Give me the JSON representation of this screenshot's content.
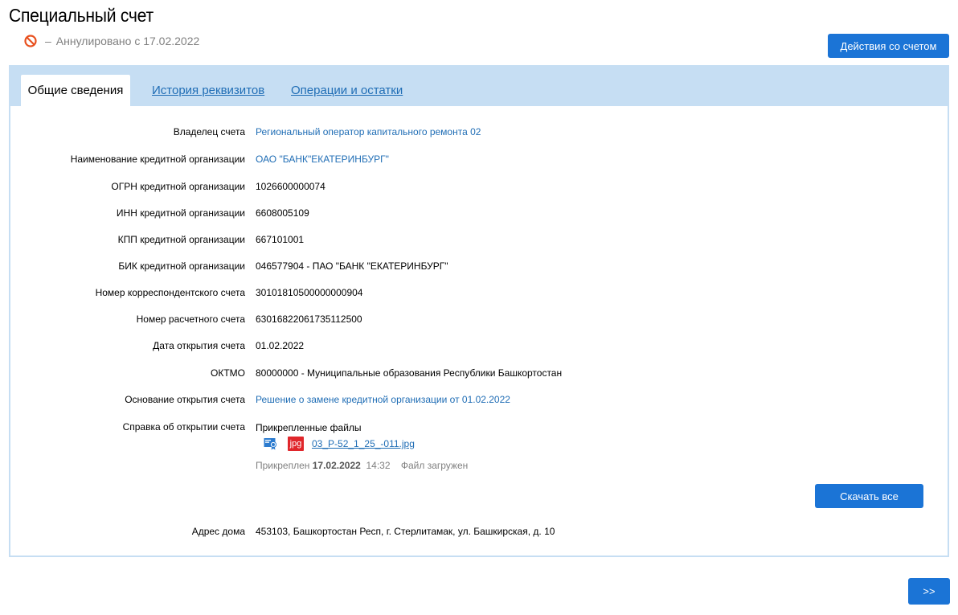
{
  "header": {
    "title": "Специальный счет",
    "status_dash": "–",
    "status_text": "Аннулировано с 17.02.2022",
    "actions_label": "Действия со счетом"
  },
  "tabs": [
    {
      "label": "Общие сведения"
    },
    {
      "label": "История реквизитов"
    },
    {
      "label": "Операции и остатки"
    }
  ],
  "fields": {
    "owner": {
      "label": "Владелец счета",
      "value": "Региональный оператор капитального ремонта 02"
    },
    "bank_name": {
      "label": "Наименование кредитной организации",
      "value": "ОАО \"БАНК\"ЕКАТЕРИНБУРГ\""
    },
    "ogrn": {
      "label": "ОГРН кредитной организации",
      "value": "1026600000074"
    },
    "inn": {
      "label": "ИНН кредитной организации",
      "value": "6608005109"
    },
    "kpp": {
      "label": "КПП кредитной организации",
      "value": "667101001"
    },
    "bik": {
      "label": "БИК кредитной организации",
      "value": "046577904 - ПАО \"БАНК \"ЕКАТЕРИНБУРГ\""
    },
    "corr_account": {
      "label": "Номер корреспондентского счета",
      "value": "30101810500000000904"
    },
    "account": {
      "label": "Номер расчетного счета",
      "value": "63016822061735112500"
    },
    "open_date": {
      "label": "Дата открытия счета",
      "value": "01.02.2022"
    },
    "oktmo": {
      "label": "ОКТМО",
      "value": "80000000 - Муниципальные образования Республики Башкортостан"
    },
    "basis": {
      "label": "Основание открытия счета",
      "value": "Решение о замене кредитной организации от 01.02.2022"
    },
    "certificate": {
      "label": "Справка об открытии счета"
    },
    "address": {
      "label": "Адрес дома",
      "value": "453103, Башкортостан Респ, г. Стерлитамак, ул. Башкирская, д. 10"
    }
  },
  "attachments": {
    "title": "Прикрепленные файлы",
    "file": {
      "type_badge": "jpg",
      "name": "03_P-52_1_25_-011.jpg",
      "attached_prefix": "Прикреплен",
      "attached_date": "17.02.2022",
      "attached_time": "14:32",
      "status": "Файл загружен"
    },
    "download_all_label": "Скачать все"
  },
  "footer": {
    "next_label": ">>"
  }
}
